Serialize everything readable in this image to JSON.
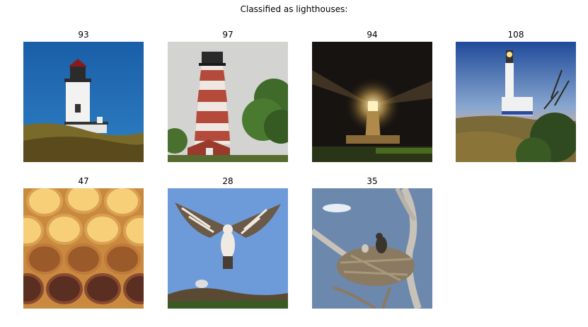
{
  "title": "Classified as lighthouses:",
  "images": [
    {
      "label": "93",
      "subject": "lighthouse-day"
    },
    {
      "label": "97",
      "subject": "lighthouse-striped"
    },
    {
      "label": "94",
      "subject": "lighthouse-night"
    },
    {
      "label": "108",
      "subject": "lighthouse-dusk"
    },
    {
      "label": "47",
      "subject": "honeycomb"
    },
    {
      "label": "28",
      "subject": "osprey-flying"
    },
    {
      "label": "35",
      "subject": "osprey-nest"
    }
  ],
  "chart_data": {
    "type": "table",
    "title": "Classified as lighthouses:",
    "categories": [
      "93",
      "97",
      "94",
      "108",
      "47",
      "28",
      "35"
    ]
  }
}
